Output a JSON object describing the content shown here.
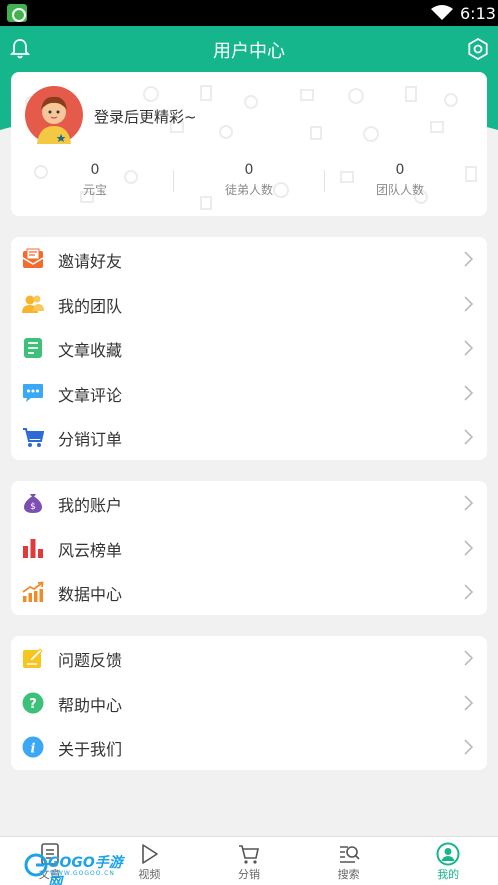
{
  "status_bar": {
    "time": "6:13"
  },
  "header": {
    "title": "用户中心",
    "bell_icon": "bell-icon",
    "settings_icon": "gear-icon"
  },
  "profile": {
    "login_prompt": "登录后更精彩~",
    "stats": [
      {
        "value": "0",
        "label": "元宝"
      },
      {
        "value": "0",
        "label": "徒弟人数"
      },
      {
        "value": "0",
        "label": "团队人数"
      }
    ]
  },
  "menu_groups": [
    [
      {
        "label": "邀请好友",
        "icon": "envelope-icon"
      },
      {
        "label": "我的团队",
        "icon": "team-icon"
      },
      {
        "label": "文章收藏",
        "icon": "document-icon"
      },
      {
        "label": "文章评论",
        "icon": "comment-icon"
      },
      {
        "label": "分销订单",
        "icon": "cart-icon"
      }
    ],
    [
      {
        "label": "我的账户",
        "icon": "money-bag-icon"
      },
      {
        "label": "风云榜单",
        "icon": "bar-chart-icon"
      },
      {
        "label": "数据中心",
        "icon": "trend-chart-icon"
      }
    ],
    [
      {
        "label": "问题反馈",
        "icon": "edit-icon"
      },
      {
        "label": "帮助中心",
        "icon": "help-icon"
      },
      {
        "label": "关于我们",
        "icon": "info-icon"
      }
    ]
  ],
  "tabs": [
    {
      "label": "文章",
      "icon": "article-icon"
    },
    {
      "label": "视频",
      "icon": "play-icon"
    },
    {
      "label": "分销",
      "icon": "cart-icon"
    },
    {
      "label": "搜索",
      "icon": "search-icon"
    },
    {
      "label": "我的",
      "icon": "user-icon",
      "active": true
    }
  ],
  "watermark": {
    "text": "GOGO手游网",
    "sub": "WWW.GOGOO.CN"
  },
  "colors": {
    "primary": "#15b68c",
    "envelope": "#f26b2f",
    "team": "#f7b52c",
    "document": "#3cc07a",
    "comment": "#3ba8f5",
    "cart": "#2c6bd6",
    "money": "#7b4fb3",
    "bar_chart": "#e23a3a",
    "trend": "#f28a2a",
    "edit": "#f6c51f",
    "help": "#3cc07a",
    "info": "#3ba8f5"
  }
}
